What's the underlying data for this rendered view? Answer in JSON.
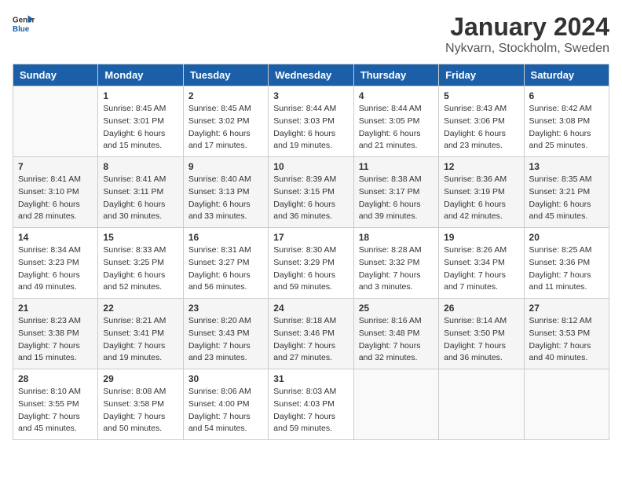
{
  "logo": {
    "general": "General",
    "blue": "Blue"
  },
  "title": "January 2024",
  "subtitle": "Nykvarn, Stockholm, Sweden",
  "headers": [
    "Sunday",
    "Monday",
    "Tuesday",
    "Wednesday",
    "Thursday",
    "Friday",
    "Saturday"
  ],
  "weeks": [
    [
      {
        "day": "",
        "sunrise": "",
        "sunset": "",
        "daylight": ""
      },
      {
        "day": "1",
        "sunrise": "Sunrise: 8:45 AM",
        "sunset": "Sunset: 3:01 PM",
        "daylight": "Daylight: 6 hours and 15 minutes."
      },
      {
        "day": "2",
        "sunrise": "Sunrise: 8:45 AM",
        "sunset": "Sunset: 3:02 PM",
        "daylight": "Daylight: 6 hours and 17 minutes."
      },
      {
        "day": "3",
        "sunrise": "Sunrise: 8:44 AM",
        "sunset": "Sunset: 3:03 PM",
        "daylight": "Daylight: 6 hours and 19 minutes."
      },
      {
        "day": "4",
        "sunrise": "Sunrise: 8:44 AM",
        "sunset": "Sunset: 3:05 PM",
        "daylight": "Daylight: 6 hours and 21 minutes."
      },
      {
        "day": "5",
        "sunrise": "Sunrise: 8:43 AM",
        "sunset": "Sunset: 3:06 PM",
        "daylight": "Daylight: 6 hours and 23 minutes."
      },
      {
        "day": "6",
        "sunrise": "Sunrise: 8:42 AM",
        "sunset": "Sunset: 3:08 PM",
        "daylight": "Daylight: 6 hours and 25 minutes."
      }
    ],
    [
      {
        "day": "7",
        "sunrise": "Sunrise: 8:41 AM",
        "sunset": "Sunset: 3:10 PM",
        "daylight": "Daylight: 6 hours and 28 minutes."
      },
      {
        "day": "8",
        "sunrise": "Sunrise: 8:41 AM",
        "sunset": "Sunset: 3:11 PM",
        "daylight": "Daylight: 6 hours and 30 minutes."
      },
      {
        "day": "9",
        "sunrise": "Sunrise: 8:40 AM",
        "sunset": "Sunset: 3:13 PM",
        "daylight": "Daylight: 6 hours and 33 minutes."
      },
      {
        "day": "10",
        "sunrise": "Sunrise: 8:39 AM",
        "sunset": "Sunset: 3:15 PM",
        "daylight": "Daylight: 6 hours and 36 minutes."
      },
      {
        "day": "11",
        "sunrise": "Sunrise: 8:38 AM",
        "sunset": "Sunset: 3:17 PM",
        "daylight": "Daylight: 6 hours and 39 minutes."
      },
      {
        "day": "12",
        "sunrise": "Sunrise: 8:36 AM",
        "sunset": "Sunset: 3:19 PM",
        "daylight": "Daylight: 6 hours and 42 minutes."
      },
      {
        "day": "13",
        "sunrise": "Sunrise: 8:35 AM",
        "sunset": "Sunset: 3:21 PM",
        "daylight": "Daylight: 6 hours and 45 minutes."
      }
    ],
    [
      {
        "day": "14",
        "sunrise": "Sunrise: 8:34 AM",
        "sunset": "Sunset: 3:23 PM",
        "daylight": "Daylight: 6 hours and 49 minutes."
      },
      {
        "day": "15",
        "sunrise": "Sunrise: 8:33 AM",
        "sunset": "Sunset: 3:25 PM",
        "daylight": "Daylight: 6 hours and 52 minutes."
      },
      {
        "day": "16",
        "sunrise": "Sunrise: 8:31 AM",
        "sunset": "Sunset: 3:27 PM",
        "daylight": "Daylight: 6 hours and 56 minutes."
      },
      {
        "day": "17",
        "sunrise": "Sunrise: 8:30 AM",
        "sunset": "Sunset: 3:29 PM",
        "daylight": "Daylight: 6 hours and 59 minutes."
      },
      {
        "day": "18",
        "sunrise": "Sunrise: 8:28 AM",
        "sunset": "Sunset: 3:32 PM",
        "daylight": "Daylight: 7 hours and 3 minutes."
      },
      {
        "day": "19",
        "sunrise": "Sunrise: 8:26 AM",
        "sunset": "Sunset: 3:34 PM",
        "daylight": "Daylight: 7 hours and 7 minutes."
      },
      {
        "day": "20",
        "sunrise": "Sunrise: 8:25 AM",
        "sunset": "Sunset: 3:36 PM",
        "daylight": "Daylight: 7 hours and 11 minutes."
      }
    ],
    [
      {
        "day": "21",
        "sunrise": "Sunrise: 8:23 AM",
        "sunset": "Sunset: 3:38 PM",
        "daylight": "Daylight: 7 hours and 15 minutes."
      },
      {
        "day": "22",
        "sunrise": "Sunrise: 8:21 AM",
        "sunset": "Sunset: 3:41 PM",
        "daylight": "Daylight: 7 hours and 19 minutes."
      },
      {
        "day": "23",
        "sunrise": "Sunrise: 8:20 AM",
        "sunset": "Sunset: 3:43 PM",
        "daylight": "Daylight: 7 hours and 23 minutes."
      },
      {
        "day": "24",
        "sunrise": "Sunrise: 8:18 AM",
        "sunset": "Sunset: 3:46 PM",
        "daylight": "Daylight: 7 hours and 27 minutes."
      },
      {
        "day": "25",
        "sunrise": "Sunrise: 8:16 AM",
        "sunset": "Sunset: 3:48 PM",
        "daylight": "Daylight: 7 hours and 32 minutes."
      },
      {
        "day": "26",
        "sunrise": "Sunrise: 8:14 AM",
        "sunset": "Sunset: 3:50 PM",
        "daylight": "Daylight: 7 hours and 36 minutes."
      },
      {
        "day": "27",
        "sunrise": "Sunrise: 8:12 AM",
        "sunset": "Sunset: 3:53 PM",
        "daylight": "Daylight: 7 hours and 40 minutes."
      }
    ],
    [
      {
        "day": "28",
        "sunrise": "Sunrise: 8:10 AM",
        "sunset": "Sunset: 3:55 PM",
        "daylight": "Daylight: 7 hours and 45 minutes."
      },
      {
        "day": "29",
        "sunrise": "Sunrise: 8:08 AM",
        "sunset": "Sunset: 3:58 PM",
        "daylight": "Daylight: 7 hours and 50 minutes."
      },
      {
        "day": "30",
        "sunrise": "Sunrise: 8:06 AM",
        "sunset": "Sunset: 4:00 PM",
        "daylight": "Daylight: 7 hours and 54 minutes."
      },
      {
        "day": "31",
        "sunrise": "Sunrise: 8:03 AM",
        "sunset": "Sunset: 4:03 PM",
        "daylight": "Daylight: 7 hours and 59 minutes."
      },
      {
        "day": "",
        "sunrise": "",
        "sunset": "",
        "daylight": ""
      },
      {
        "day": "",
        "sunrise": "",
        "sunset": "",
        "daylight": ""
      },
      {
        "day": "",
        "sunrise": "",
        "sunset": "",
        "daylight": ""
      }
    ]
  ]
}
